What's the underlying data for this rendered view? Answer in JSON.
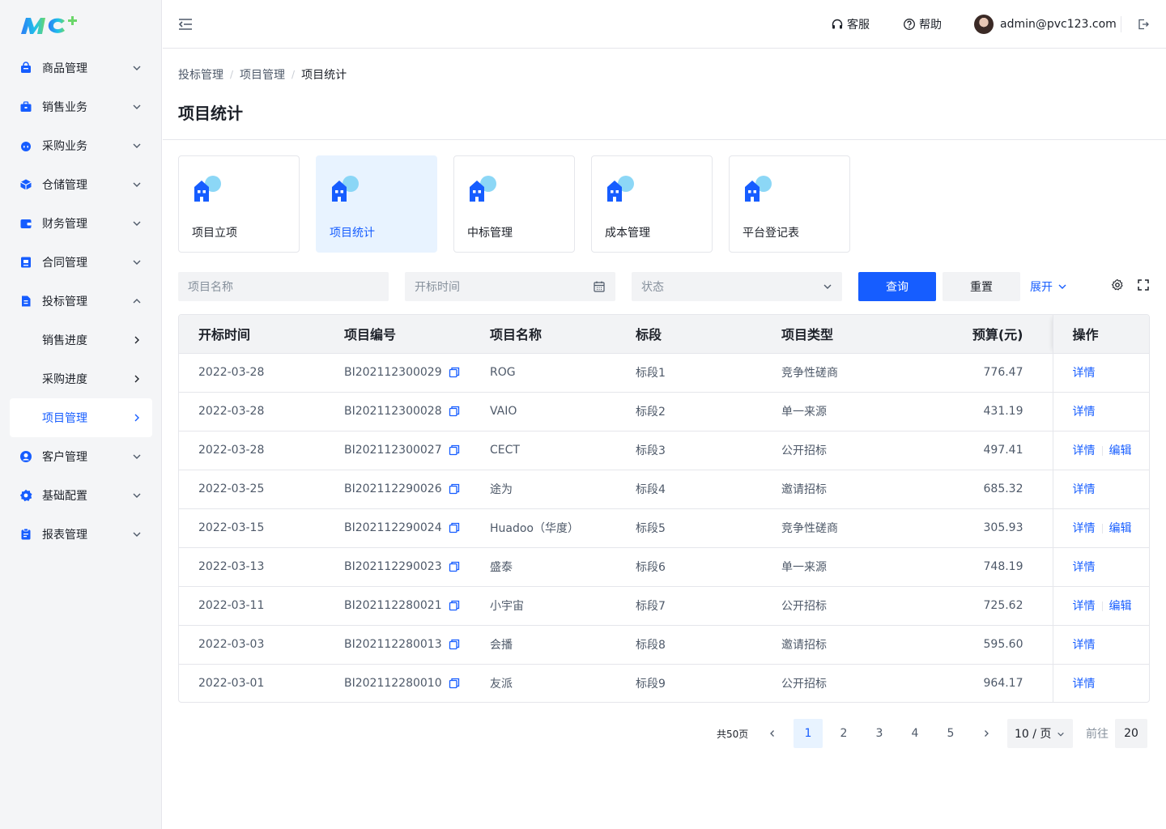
{
  "sidebar": {
    "items": [
      {
        "label": "商品管理",
        "icon": "bag-icon",
        "expanded": false
      },
      {
        "label": "销售业务",
        "icon": "briefcase-icon",
        "expanded": false
      },
      {
        "label": "采购业务",
        "icon": "basket-icon",
        "expanded": false
      },
      {
        "label": "仓储管理",
        "icon": "box-icon",
        "expanded": false
      },
      {
        "label": "财务管理",
        "icon": "wallet-icon",
        "expanded": false
      },
      {
        "label": "合同管理",
        "icon": "contract-icon",
        "expanded": false
      },
      {
        "label": "投标管理",
        "icon": "document-icon",
        "expanded": true
      },
      {
        "label": "客户管理",
        "icon": "user-circle-icon",
        "expanded": false
      },
      {
        "label": "基础配置",
        "icon": "settings-icon",
        "expanded": false
      },
      {
        "label": "报表管理",
        "icon": "clipboard-icon",
        "expanded": false
      }
    ],
    "subitems": [
      {
        "label": "销售进度"
      },
      {
        "label": "采购进度"
      },
      {
        "label": "项目管理",
        "active": true
      }
    ]
  },
  "header": {
    "service": "客服",
    "help": "帮助",
    "user": "admin@pvc123.com"
  },
  "breadcrumb": [
    "投标管理",
    "项目管理",
    "项目统计"
  ],
  "page_title": "项目统计",
  "cards": [
    {
      "label": "项目立项",
      "active": false
    },
    {
      "label": "项目统计",
      "active": true
    },
    {
      "label": "中标管理",
      "active": false
    },
    {
      "label": "成本管理",
      "active": false
    },
    {
      "label": "平台登记表",
      "active": false
    }
  ],
  "filters": {
    "name_placeholder": "项目名称",
    "time_placeholder": "开标时间",
    "status_placeholder": "状态",
    "query": "查询",
    "reset": "重置",
    "expand": "展开"
  },
  "table": {
    "columns": [
      "开标时间",
      "项目编号",
      "项目名称",
      "标段",
      "项目类型",
      "预算(元)",
      "操作"
    ],
    "rows": [
      {
        "time": "2022-03-28",
        "code": "BI202112300029",
        "name": "ROG",
        "section": "标段1",
        "type": "竞争性磋商",
        "budget": "776.47",
        "ops": [
          "详情"
        ]
      },
      {
        "time": "2022-03-28",
        "code": "BI202112300028",
        "name": "VAIO",
        "section": "标段2",
        "type": "单一来源",
        "budget": "431.19",
        "ops": [
          "详情"
        ]
      },
      {
        "time": "2022-03-28",
        "code": "BI202112300027",
        "name": "CECT",
        "section": "标段3",
        "type": "公开招标",
        "budget": "497.41",
        "ops": [
          "详情",
          "编辑"
        ]
      },
      {
        "time": "2022-03-25",
        "code": "BI202112290026",
        "name": "途为",
        "section": "标段4",
        "type": "邀请招标",
        "budget": "685.32",
        "ops": [
          "详情"
        ]
      },
      {
        "time": "2022-03-15",
        "code": "BI202112290024",
        "name": "Huadoo（华度）",
        "section": "标段5",
        "type": "竞争性磋商",
        "budget": "305.93",
        "ops": [
          "详情",
          "编辑"
        ]
      },
      {
        "time": "2022-03-13",
        "code": "BI202112290023",
        "name": "盛泰",
        "section": "标段6",
        "type": "单一来源",
        "budget": "748.19",
        "ops": [
          "详情"
        ]
      },
      {
        "time": "2022-03-11",
        "code": "BI202112280021",
        "name": "小宇宙",
        "section": "标段7",
        "type": "公开招标",
        "budget": "725.62",
        "ops": [
          "详情",
          "编辑"
        ]
      },
      {
        "time": "2022-03-03",
        "code": "BI202112280013",
        "name": "会播",
        "section": "标段8",
        "type": "邀请招标",
        "budget": "595.60",
        "ops": [
          "详情"
        ]
      },
      {
        "time": "2022-03-01",
        "code": "BI202112280010",
        "name": "友派",
        "section": "标段9",
        "type": "公开招标",
        "budget": "964.17",
        "ops": [
          "详情"
        ]
      }
    ]
  },
  "pagination": {
    "total": "共50页",
    "pages": [
      "1",
      "2",
      "3",
      "4",
      "5"
    ],
    "current": "1",
    "size": "10 / 页",
    "goto": "前往",
    "goto_value": "20"
  },
  "colors": {
    "primary": "#165dff",
    "sidebar_bg": "#f4f5f7",
    "header_bg": "#f2f3f5"
  }
}
